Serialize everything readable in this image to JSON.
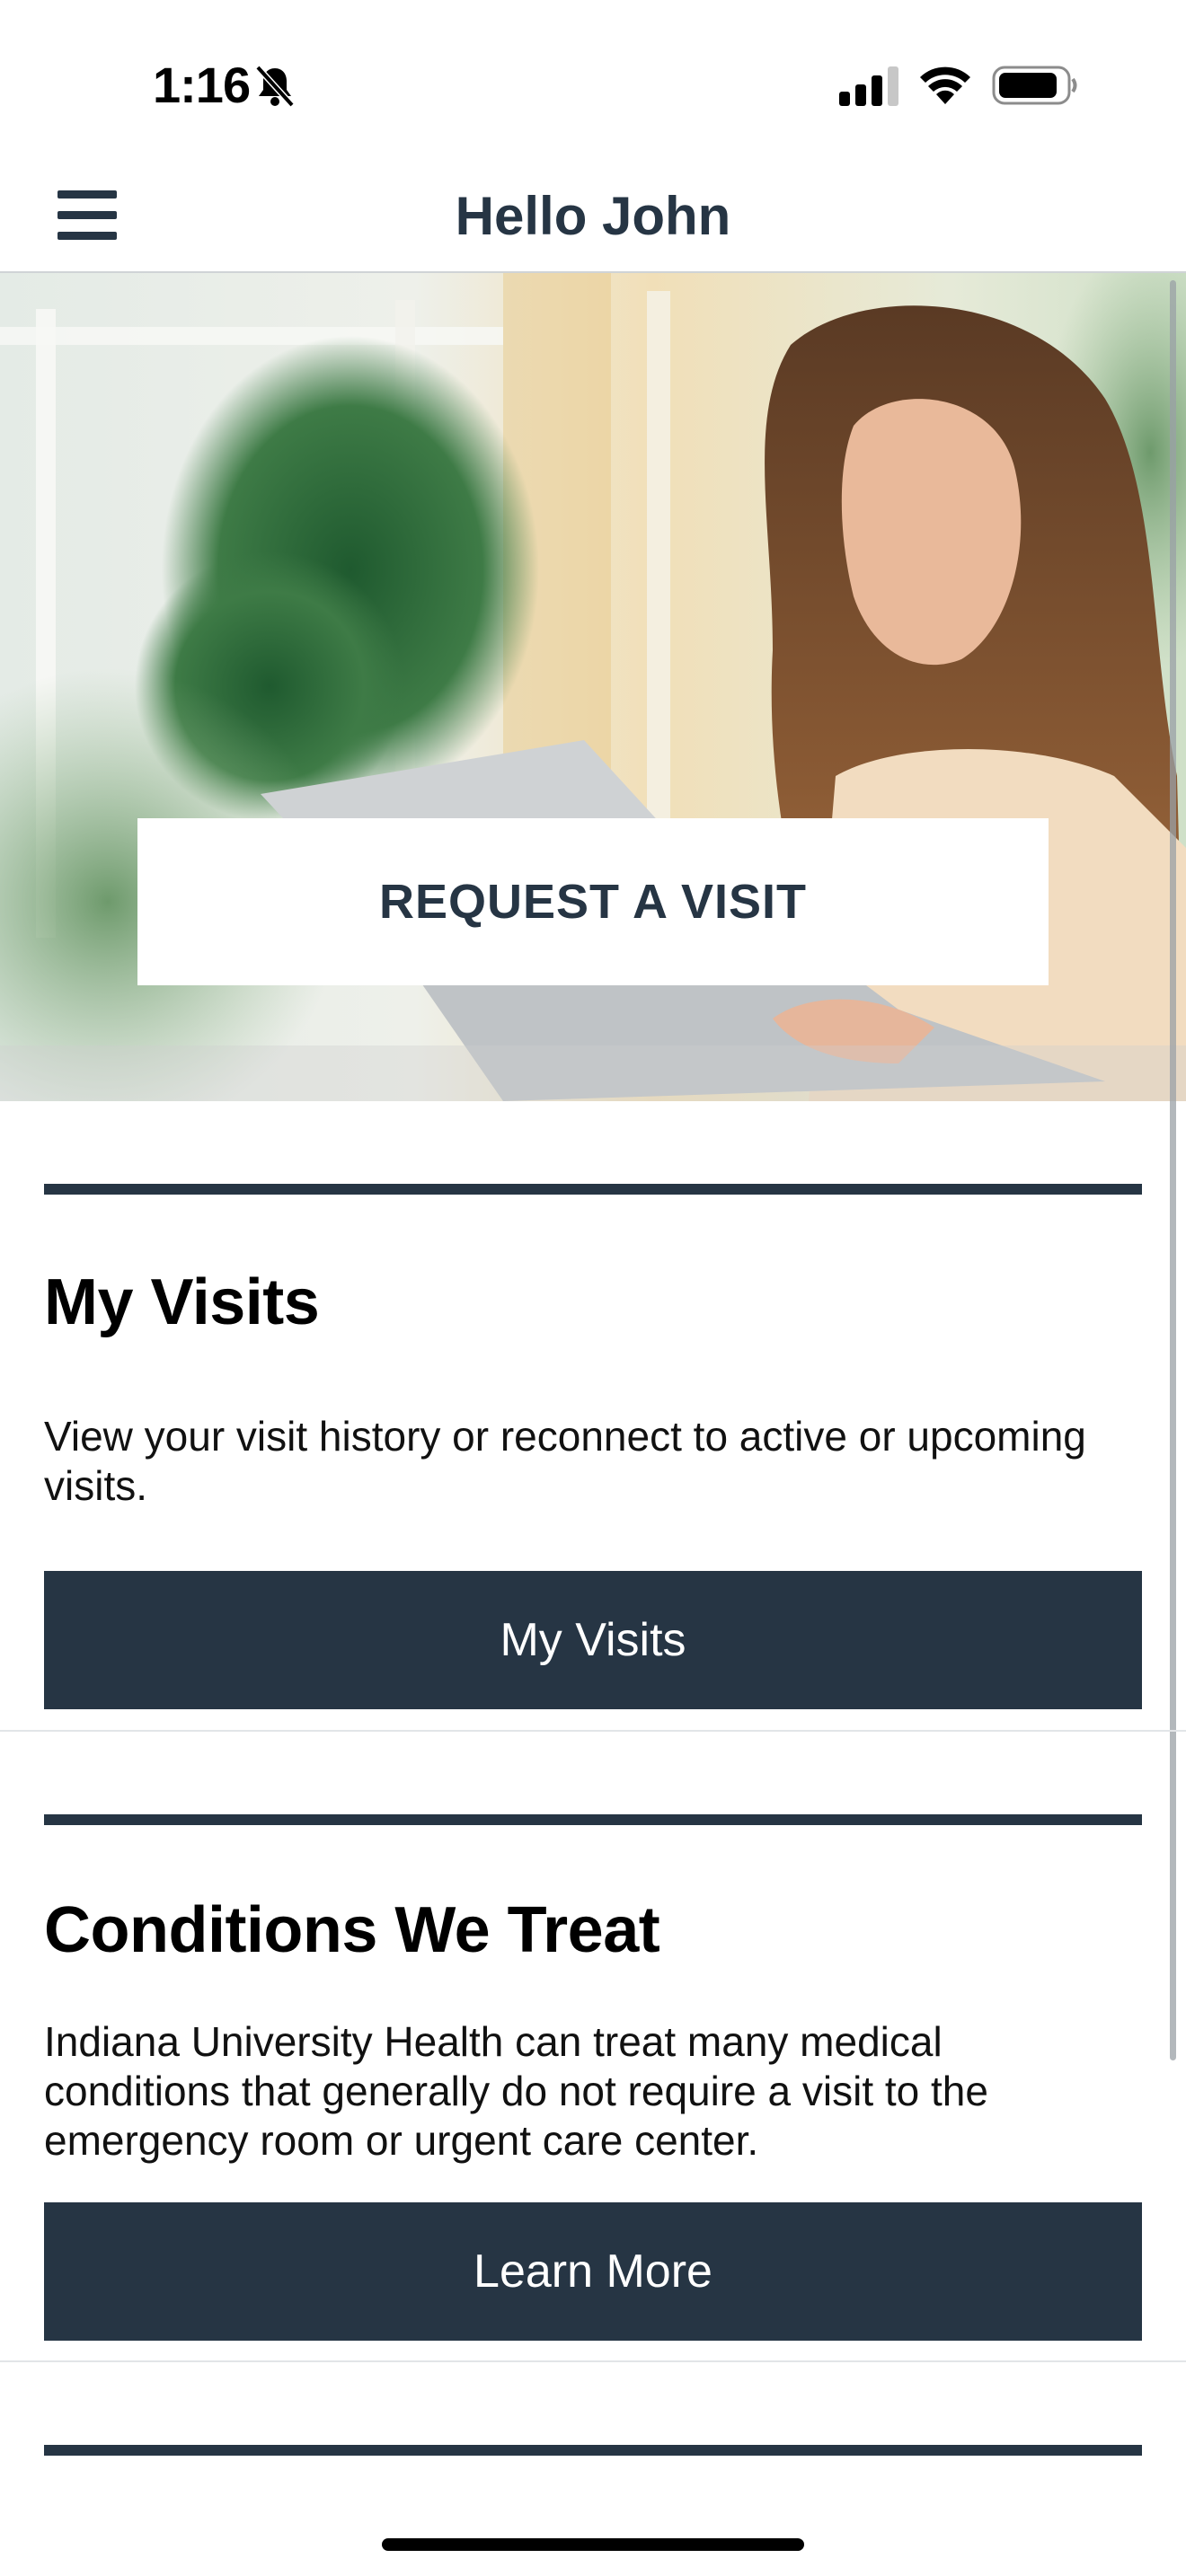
{
  "status_bar": {
    "time": "1:16",
    "icons": [
      "bell-slash-icon",
      "cellular-signal-icon",
      "wifi-icon",
      "battery-icon"
    ]
  },
  "header": {
    "title": "Hello John",
    "menu_icon": "hamburger-menu-icon"
  },
  "hero": {
    "image": "woman-using-laptop-photo",
    "request_button_label": "REQUEST A VISIT"
  },
  "sections": [
    {
      "heading": "My Visits",
      "description": "View your visit history or reconnect to active or upcoming visits.",
      "button_label": "My Visits"
    },
    {
      "heading": "Conditions We Treat",
      "description": "Indiana University Health can treat many medical conditions that generally do not require a visit to the emergency room or urgent care center.",
      "button_label": "Learn More"
    }
  ],
  "colors": {
    "brand_dark": "#263544",
    "background": "#ffffff"
  }
}
